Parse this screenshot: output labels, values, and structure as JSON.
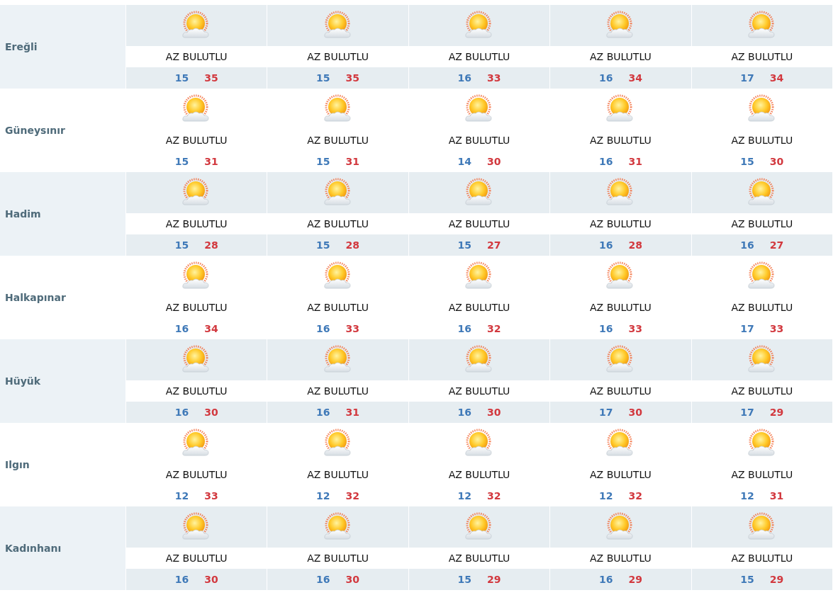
{
  "locations": [
    {
      "name": "Ereğli",
      "days": [
        {
          "condition": "AZ BULUTLU",
          "low": "15",
          "high": "35"
        },
        {
          "condition": "AZ BULUTLU",
          "low": "15",
          "high": "35"
        },
        {
          "condition": "AZ BULUTLU",
          "low": "16",
          "high": "33"
        },
        {
          "condition": "AZ BULUTLU",
          "low": "16",
          "high": "34"
        },
        {
          "condition": "AZ BULUTLU",
          "low": "17",
          "high": "34"
        }
      ]
    },
    {
      "name": "Güneysınır",
      "days": [
        {
          "condition": "AZ BULUTLU",
          "low": "15",
          "high": "31"
        },
        {
          "condition": "AZ BULUTLU",
          "low": "15",
          "high": "31"
        },
        {
          "condition": "AZ BULUTLU",
          "low": "14",
          "high": "30"
        },
        {
          "condition": "AZ BULUTLU",
          "low": "16",
          "high": "31"
        },
        {
          "condition": "AZ BULUTLU",
          "low": "15",
          "high": "30"
        }
      ]
    },
    {
      "name": "Hadim",
      "days": [
        {
          "condition": "AZ BULUTLU",
          "low": "15",
          "high": "28"
        },
        {
          "condition": "AZ BULUTLU",
          "low": "15",
          "high": "28"
        },
        {
          "condition": "AZ BULUTLU",
          "low": "15",
          "high": "27"
        },
        {
          "condition": "AZ BULUTLU",
          "low": "16",
          "high": "28"
        },
        {
          "condition": "AZ BULUTLU",
          "low": "16",
          "high": "27"
        }
      ]
    },
    {
      "name": "Halkapınar",
      "days": [
        {
          "condition": "AZ BULUTLU",
          "low": "16",
          "high": "34"
        },
        {
          "condition": "AZ BULUTLU",
          "low": "16",
          "high": "33"
        },
        {
          "condition": "AZ BULUTLU",
          "low": "16",
          "high": "32"
        },
        {
          "condition": "AZ BULUTLU",
          "low": "16",
          "high": "33"
        },
        {
          "condition": "AZ BULUTLU",
          "low": "17",
          "high": "33"
        }
      ]
    },
    {
      "name": "Hüyük",
      "days": [
        {
          "condition": "AZ BULUTLU",
          "low": "16",
          "high": "30"
        },
        {
          "condition": "AZ BULUTLU",
          "low": "16",
          "high": "31"
        },
        {
          "condition": "AZ BULUTLU",
          "low": "16",
          "high": "30"
        },
        {
          "condition": "AZ BULUTLU",
          "low": "17",
          "high": "30"
        },
        {
          "condition": "AZ BULUTLU",
          "low": "17",
          "high": "29"
        }
      ]
    },
    {
      "name": "Ilgın",
      "days": [
        {
          "condition": "AZ BULUTLU",
          "low": "12",
          "high": "33"
        },
        {
          "condition": "AZ BULUTLU",
          "low": "12",
          "high": "32"
        },
        {
          "condition": "AZ BULUTLU",
          "low": "12",
          "high": "32"
        },
        {
          "condition": "AZ BULUTLU",
          "low": "12",
          "high": "32"
        },
        {
          "condition": "AZ BULUTLU",
          "low": "12",
          "high": "31"
        }
      ]
    },
    {
      "name": "Kadınhanı",
      "days": [
        {
          "condition": "AZ BULUTLU",
          "low": "16",
          "high": "30"
        },
        {
          "condition": "AZ BULUTLU",
          "low": "16",
          "high": "30"
        },
        {
          "condition": "AZ BULUTLU",
          "low": "15",
          "high": "29"
        },
        {
          "condition": "AZ BULUTLU",
          "low": "16",
          "high": "29"
        },
        {
          "condition": "AZ BULUTLU",
          "low": "15",
          "high": "29"
        }
      ]
    }
  ]
}
